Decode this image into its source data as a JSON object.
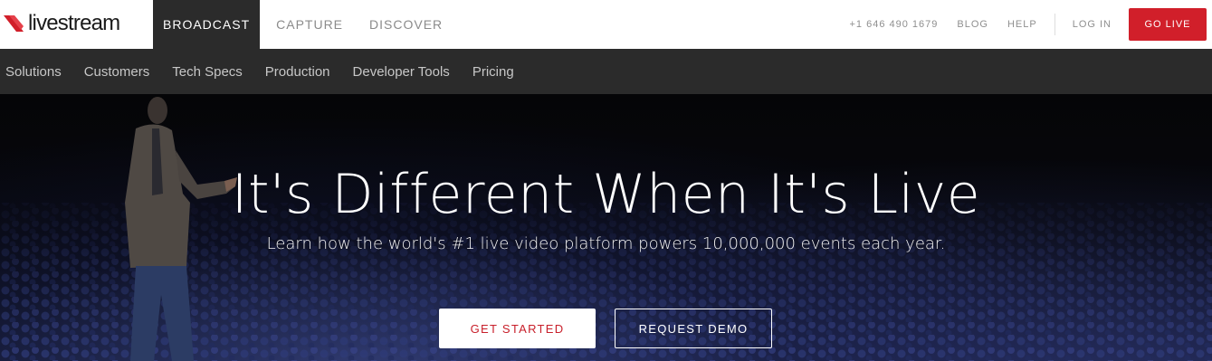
{
  "brand": {
    "name": "livestream",
    "accent": "#d11f2a"
  },
  "primary_nav": [
    {
      "label": "BROADCAST",
      "active": true
    },
    {
      "label": "CAPTURE",
      "active": false
    },
    {
      "label": "DISCOVER",
      "active": false
    }
  ],
  "utility": {
    "phone": "+1 646 490 1679",
    "blog": "BLOG",
    "help": "HELP",
    "login": "LOG IN",
    "golive": "GO LIVE"
  },
  "secondary_nav": [
    {
      "label": "Solutions"
    },
    {
      "label": "Customers"
    },
    {
      "label": "Tech Specs"
    },
    {
      "label": "Production"
    },
    {
      "label": "Developer Tools"
    },
    {
      "label": "Pricing"
    }
  ],
  "hero": {
    "headline": "It's Different When It's Live",
    "subheadline": "Learn how the world's #1 live video platform powers 10,000,000 events each year.",
    "cta_primary": "GET STARTED",
    "cta_secondary": "REQUEST DEMO"
  }
}
